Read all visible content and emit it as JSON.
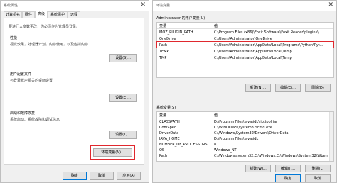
{
  "left": {
    "title": "系统属性",
    "tabs": [
      "计算机名",
      "硬件",
      "高级",
      "系统保护",
      "远程"
    ],
    "admin_note": "要进行大多数更改，你必须作为管理员登录。",
    "performance": {
      "heading": "性能",
      "desc": "视觉效果，处理器计划，内存使用，以及虚拟内存",
      "button": "设置(S)..."
    },
    "profiles": {
      "heading": "用户配置文件",
      "desc": "与登录帐户相关的桌面设置",
      "button": "设置(E)..."
    },
    "startup": {
      "heading": "启动和故障恢复",
      "desc": "系统启动、系统故障和调试信息",
      "button": "设置(T)..."
    },
    "env_button": "环境变量(N)...",
    "ok": "确定",
    "cancel": "取消",
    "apply": "应用(A)"
  },
  "right": {
    "title": "环境变量",
    "user_section_label": "Administrator 的用户变量(U)",
    "col_var": "变量",
    "col_val": "值",
    "user_vars": [
      {
        "name": "MOZ_PLUGIN_PATH",
        "value": "C:\\Program Files (x86)\\Foxit Software\\Foxit Reader\\plugins\\"
      },
      {
        "name": "OneDrive",
        "value": "C:\\Users\\Administrator\\OneDrive"
      },
      {
        "name": "Path",
        "value": "C:\\Users\\Administrator\\AppData\\Local\\Programs\\Python\\Pyt..."
      },
      {
        "name": "TEMP",
        "value": "C:\\Users\\Administrator\\AppData\\Local\\Temp"
      },
      {
        "name": "TMP",
        "value": "C:\\Users\\Administrator\\AppData\\Local\\Temp"
      }
    ],
    "user_buttons": {
      "new": "新建(N)...",
      "edit": "编辑(E)...",
      "delete": "删除(D)"
    },
    "system_section_label": "系统变量(S)",
    "system_vars": [
      {
        "name": "CLASSPATH",
        "value": "D:\\Program Files\\Java\\jdk\\lib\\tool.jar"
      },
      {
        "name": "ComSpec",
        "value": "C:\\WINDOWS\\system32\\cmd.exe"
      },
      {
        "name": "DriverData",
        "value": "C:\\Windows\\System32\\Drivers\\DriverData"
      },
      {
        "name": "JAVA_HOME",
        "value": "D:\\Program Files\\Java\\jdk"
      },
      {
        "name": "NUMBER_OF_PROCESSORS",
        "value": "8"
      },
      {
        "name": "OS",
        "value": "Windows_NT"
      },
      {
        "name": "Path",
        "value": "C:\\Windows\\system32;C:\\Windows;C:\\Windows\\System32\\Wbem;..."
      }
    ],
    "system_buttons": {
      "new": "新建(W)...",
      "edit": "编辑(I)...",
      "delete": "删除(L)"
    },
    "ok": "确定",
    "cancel": "取消"
  },
  "colors": {
    "highlight": "#e0282e",
    "accent": "#0078d7"
  }
}
